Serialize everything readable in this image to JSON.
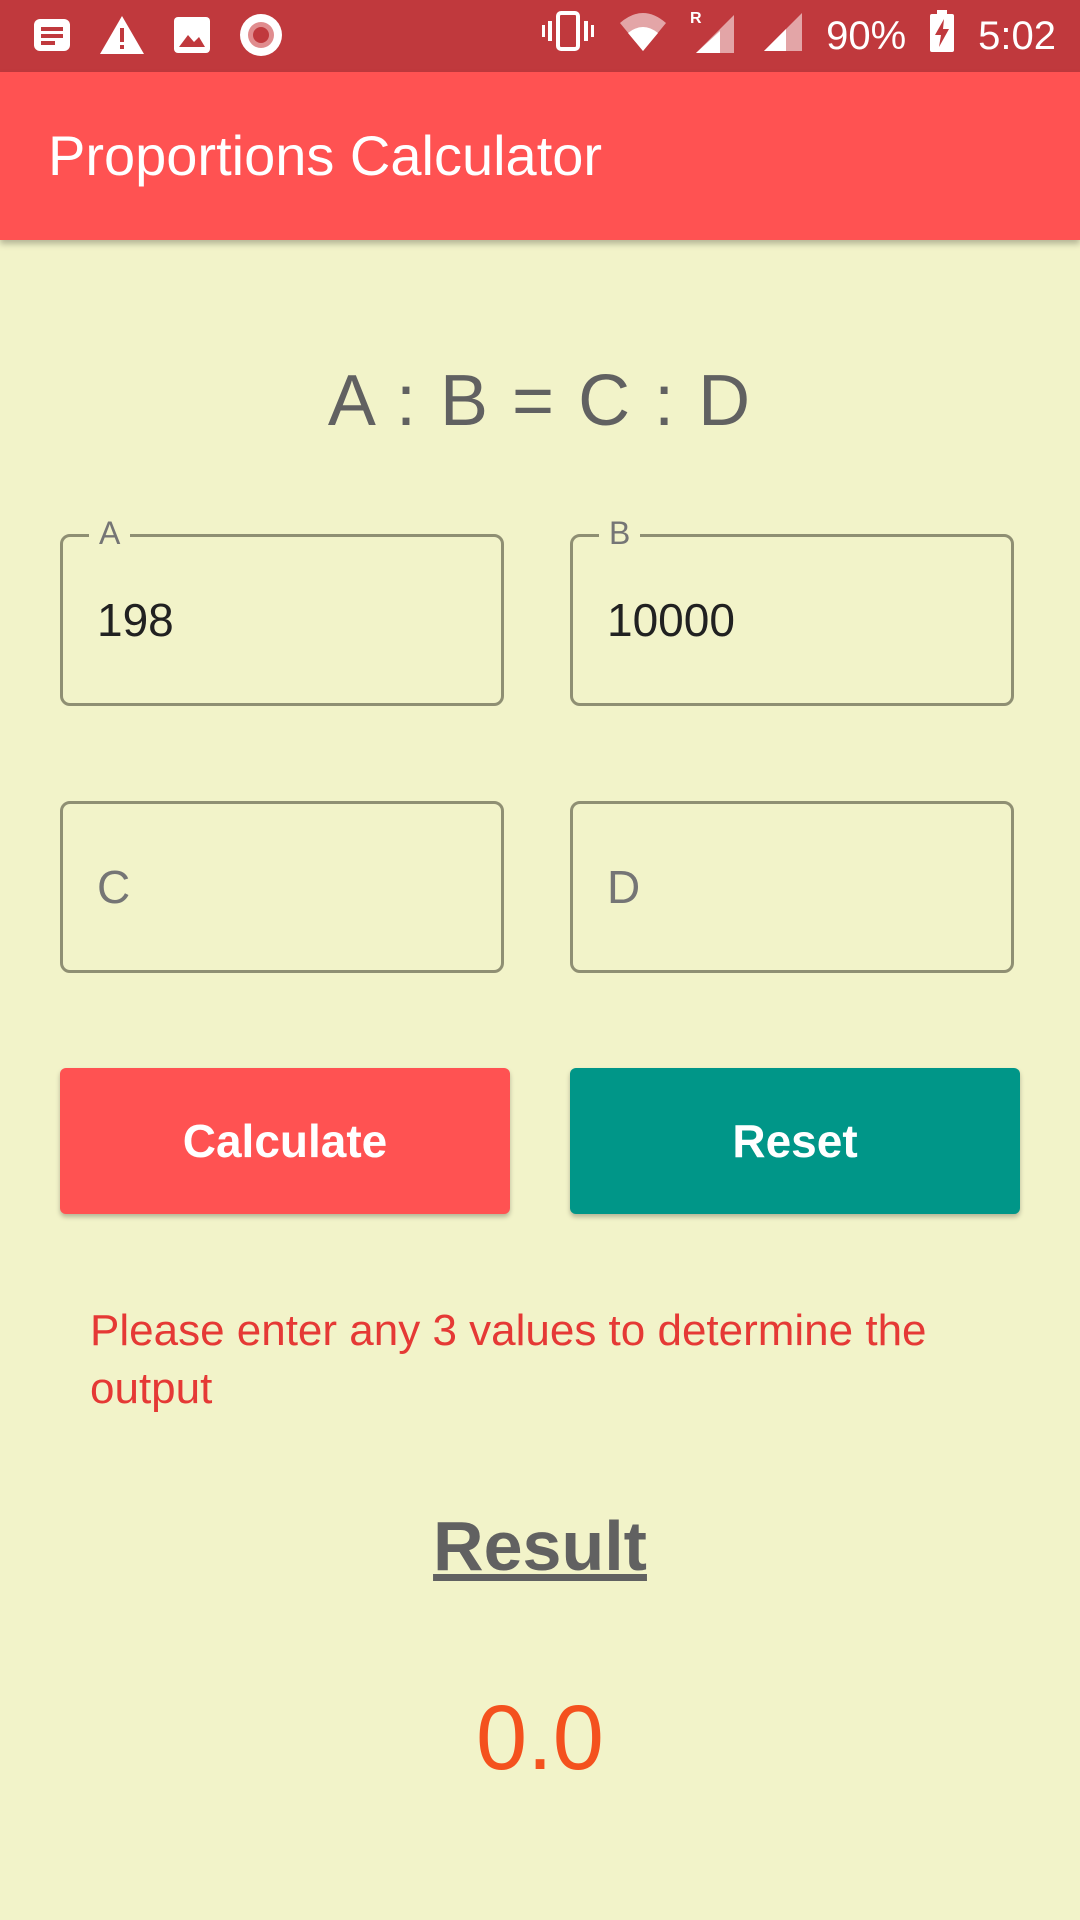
{
  "status_bar": {
    "battery": "90%",
    "time": "5:02",
    "icons": [
      "notification-icon",
      "warning-icon",
      "image-icon",
      "record-icon",
      "vibrate-icon",
      "wifi-icon",
      "signal-roaming-icon",
      "signal-icon",
      "battery-charging-icon"
    ]
  },
  "app_bar": {
    "title": "Proportions Calculator"
  },
  "formula": "A : B = C : D",
  "fields": {
    "a": {
      "label": "A",
      "value": "198"
    },
    "b": {
      "label": "B",
      "value": "10000"
    },
    "c": {
      "placeholder": "C",
      "value": ""
    },
    "d": {
      "placeholder": "D",
      "value": ""
    }
  },
  "buttons": {
    "calculate": "Calculate",
    "reset": "Reset"
  },
  "message": "Please enter any 3 values to determine the output",
  "result": {
    "title": "Result",
    "value": "0.0"
  },
  "colors": {
    "app_bar": "#ff5252",
    "status_bar": "#c0393d",
    "background": "#f2f3c9",
    "reset": "#009688",
    "error": "#e53935",
    "result": "#f4511e"
  }
}
